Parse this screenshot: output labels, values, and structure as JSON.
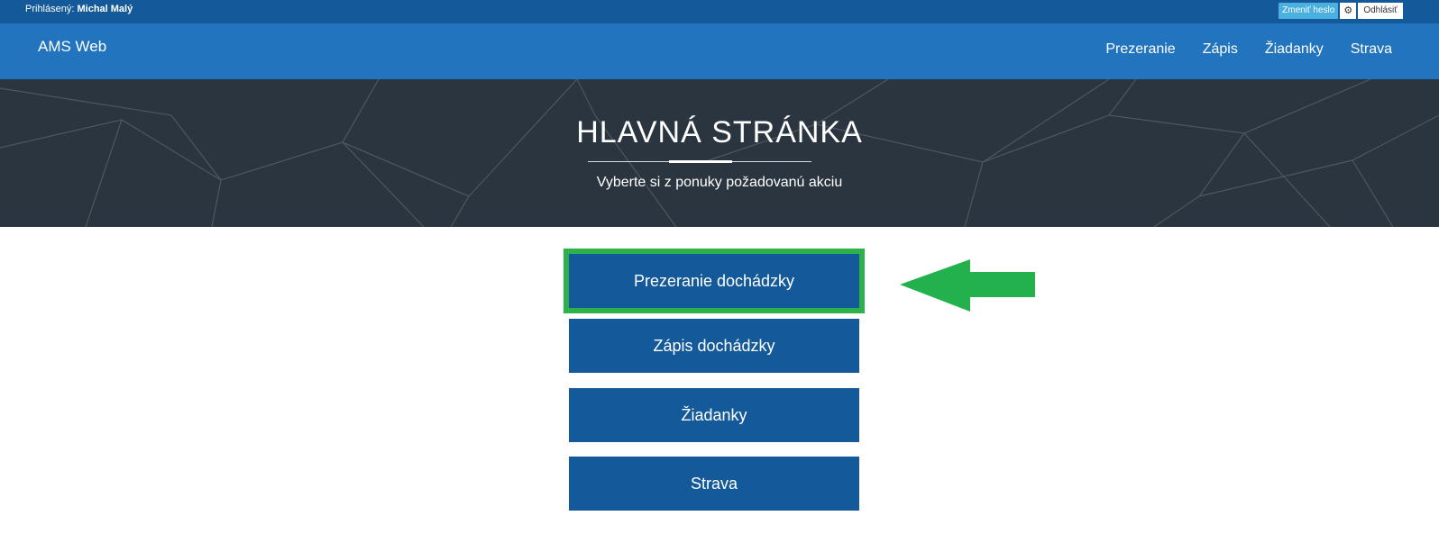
{
  "topbar": {
    "login_prefix": "Prihlásený:",
    "user_name": "Michal Malý",
    "change_password": "Zmeniť heslo",
    "logout": "Odhlásiť"
  },
  "navbar": {
    "brand": "AMS Web",
    "links": [
      "Prezeranie",
      "Zápis",
      "Žiadanky",
      "Strava"
    ]
  },
  "hero": {
    "title": "HLAVNÁ STRÁNKA",
    "subtitle": "Vyberte si z ponuky požadovanú akciu"
  },
  "actions": [
    {
      "label": "Prezeranie dochádzky",
      "highlighted": true
    },
    {
      "label": "Zápis dochádzky",
      "highlighted": false
    },
    {
      "label": "Žiadanky",
      "highlighted": false
    },
    {
      "label": "Strava",
      "highlighted": false
    }
  ],
  "colors": {
    "topbar": "#145a9a",
    "navbar": "#2174bd",
    "hero": "#2b3540",
    "button": "#145a9a",
    "highlight": "#2db14b",
    "change_password": "#4ab0e0"
  },
  "icons": {
    "settings": "gear-icon",
    "annotation": "arrow-left-icon"
  }
}
